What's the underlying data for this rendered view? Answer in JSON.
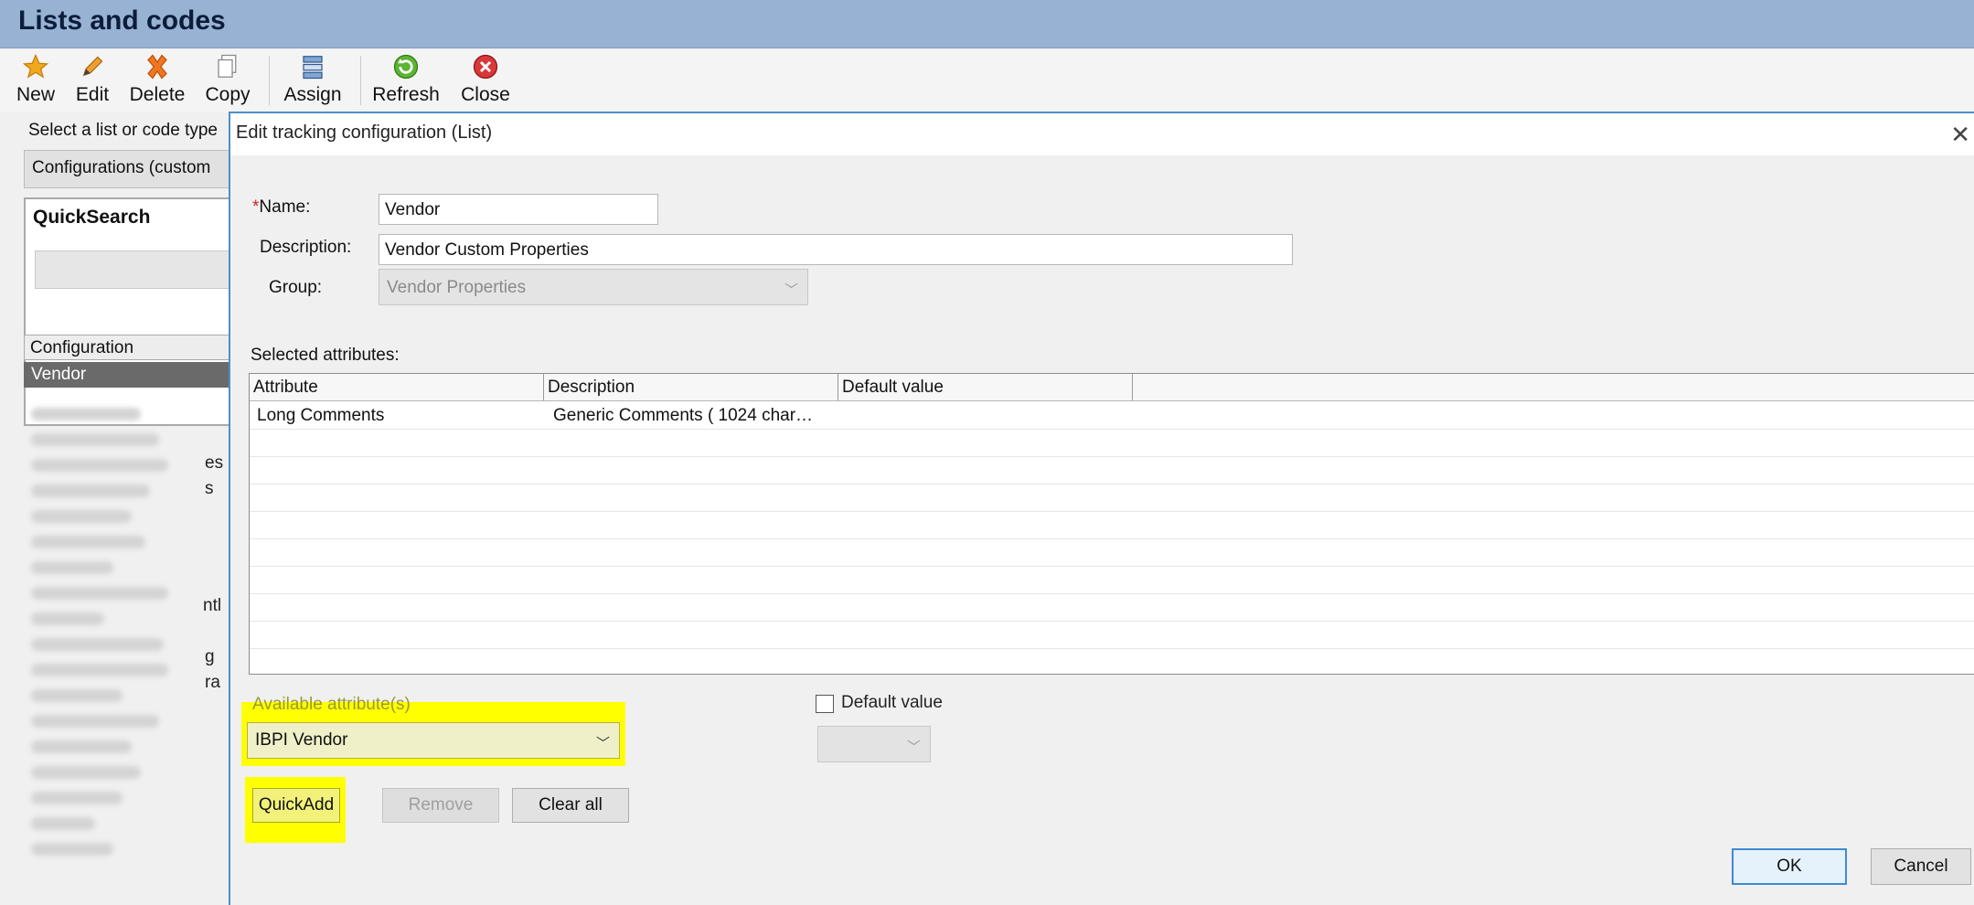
{
  "window": {
    "title": "Lists and codes"
  },
  "toolbar": {
    "new": "New",
    "edit": "Edit",
    "delete": "Delete",
    "copy": "Copy",
    "assign": "Assign",
    "refresh": "Refresh",
    "close": "Close"
  },
  "left_panel": {
    "prompt": "Select a list or code type",
    "list_type_value": "Configurations (custom",
    "quicksearch_title": "QuickSearch",
    "grid_header": "Configuration",
    "selected_item": "Vendor",
    "partial_texts": [
      "es",
      "s",
      "ntl",
      "g",
      "ra"
    ]
  },
  "dialog": {
    "title": "Edit tracking configuration (List)",
    "name_label": "Name:",
    "required_mark": "*",
    "name_value": "Vendor",
    "description_label": "Description:",
    "description_value": "Vendor Custom Properties",
    "group_label": "Group:",
    "group_value": "Vendor Properties",
    "selected_attributes_label": "Selected attributes:",
    "columns": [
      "Attribute",
      "Description",
      "Default value"
    ],
    "rows": [
      {
        "attribute": "Long Comments",
        "description": "Generic Comments ( 1024 char…",
        "default_value": ""
      }
    ],
    "available_label": "Available attribute(s)",
    "available_value": "IBPI Vendor",
    "default_value_label": "Default value",
    "default_value_checked": false,
    "quickadd": "QuickAdd",
    "remove": "Remove",
    "clear_all": "Clear all",
    "ok": "OK",
    "cancel": "Cancel"
  },
  "colors": {
    "title_bar": "#98b2d4",
    "dialog_border": "#4f8ec9",
    "highlight": "#ffff00",
    "selected_row": "#6a6a6a"
  }
}
